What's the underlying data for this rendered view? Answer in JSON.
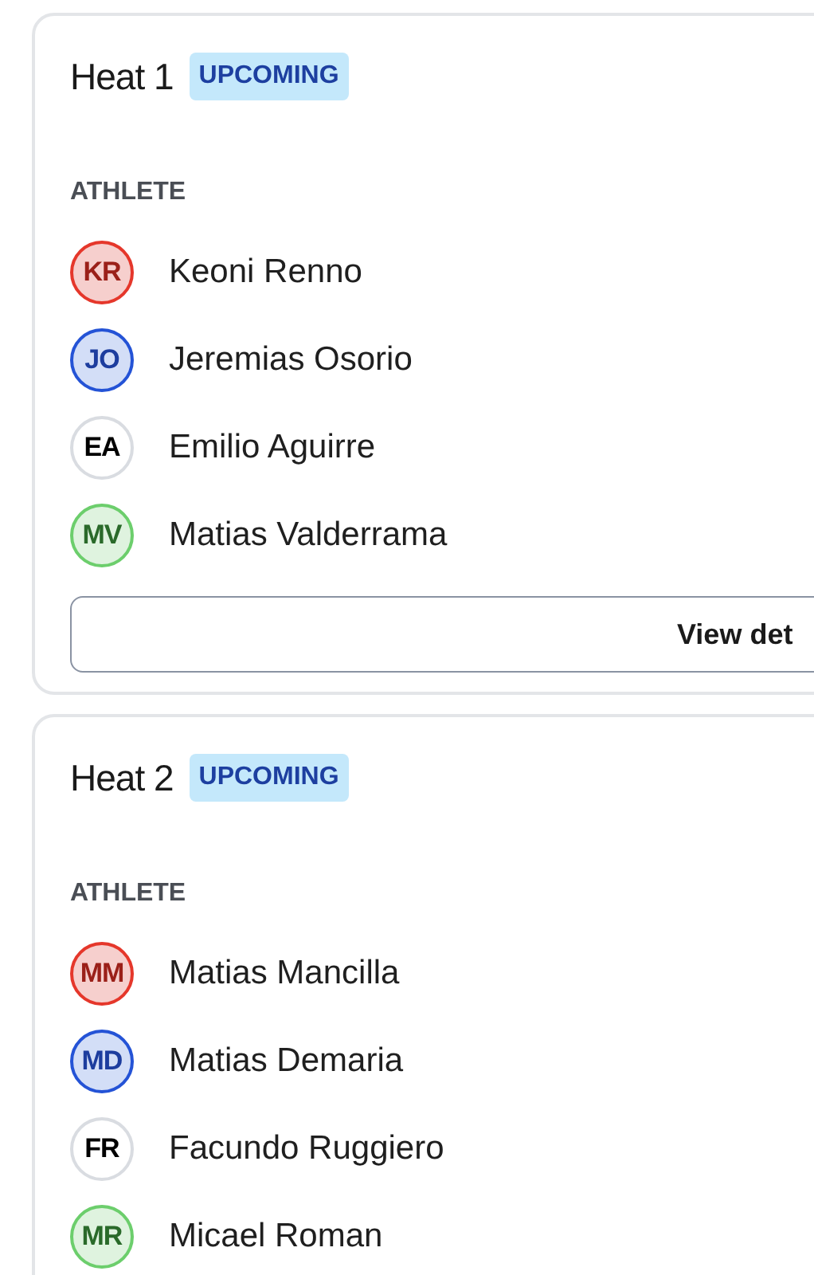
{
  "heats": [
    {
      "title": "Heat 1",
      "status": "UPCOMING",
      "column": "ATHLETE",
      "athletes": [
        {
          "initials": "KR",
          "name": "Keoni Renno",
          "color": "#e5372b"
        },
        {
          "initials": "JO",
          "name": "Jeremias Osorio",
          "color": "#2453d6"
        },
        {
          "initials": "EA",
          "name": "Emilio Aguirre",
          "color": "#d9dce1"
        },
        {
          "initials": "MV",
          "name": "Matias Valderrama",
          "color": "#6cce6c"
        }
      ],
      "button": "View det"
    },
    {
      "title": "Heat 2",
      "status": "UPCOMING",
      "column": "ATHLETE",
      "athletes": [
        {
          "initials": "MM",
          "name": "Matias Mancilla",
          "color": "#e5372b"
        },
        {
          "initials": "MD",
          "name": "Matias Demaria",
          "color": "#2453d6"
        },
        {
          "initials": "FR",
          "name": "Facundo Ruggiero",
          "color": "#d9dce1"
        },
        {
          "initials": "MR",
          "name": "Micael Roman",
          "color": "#6cce6c"
        }
      ]
    }
  ]
}
